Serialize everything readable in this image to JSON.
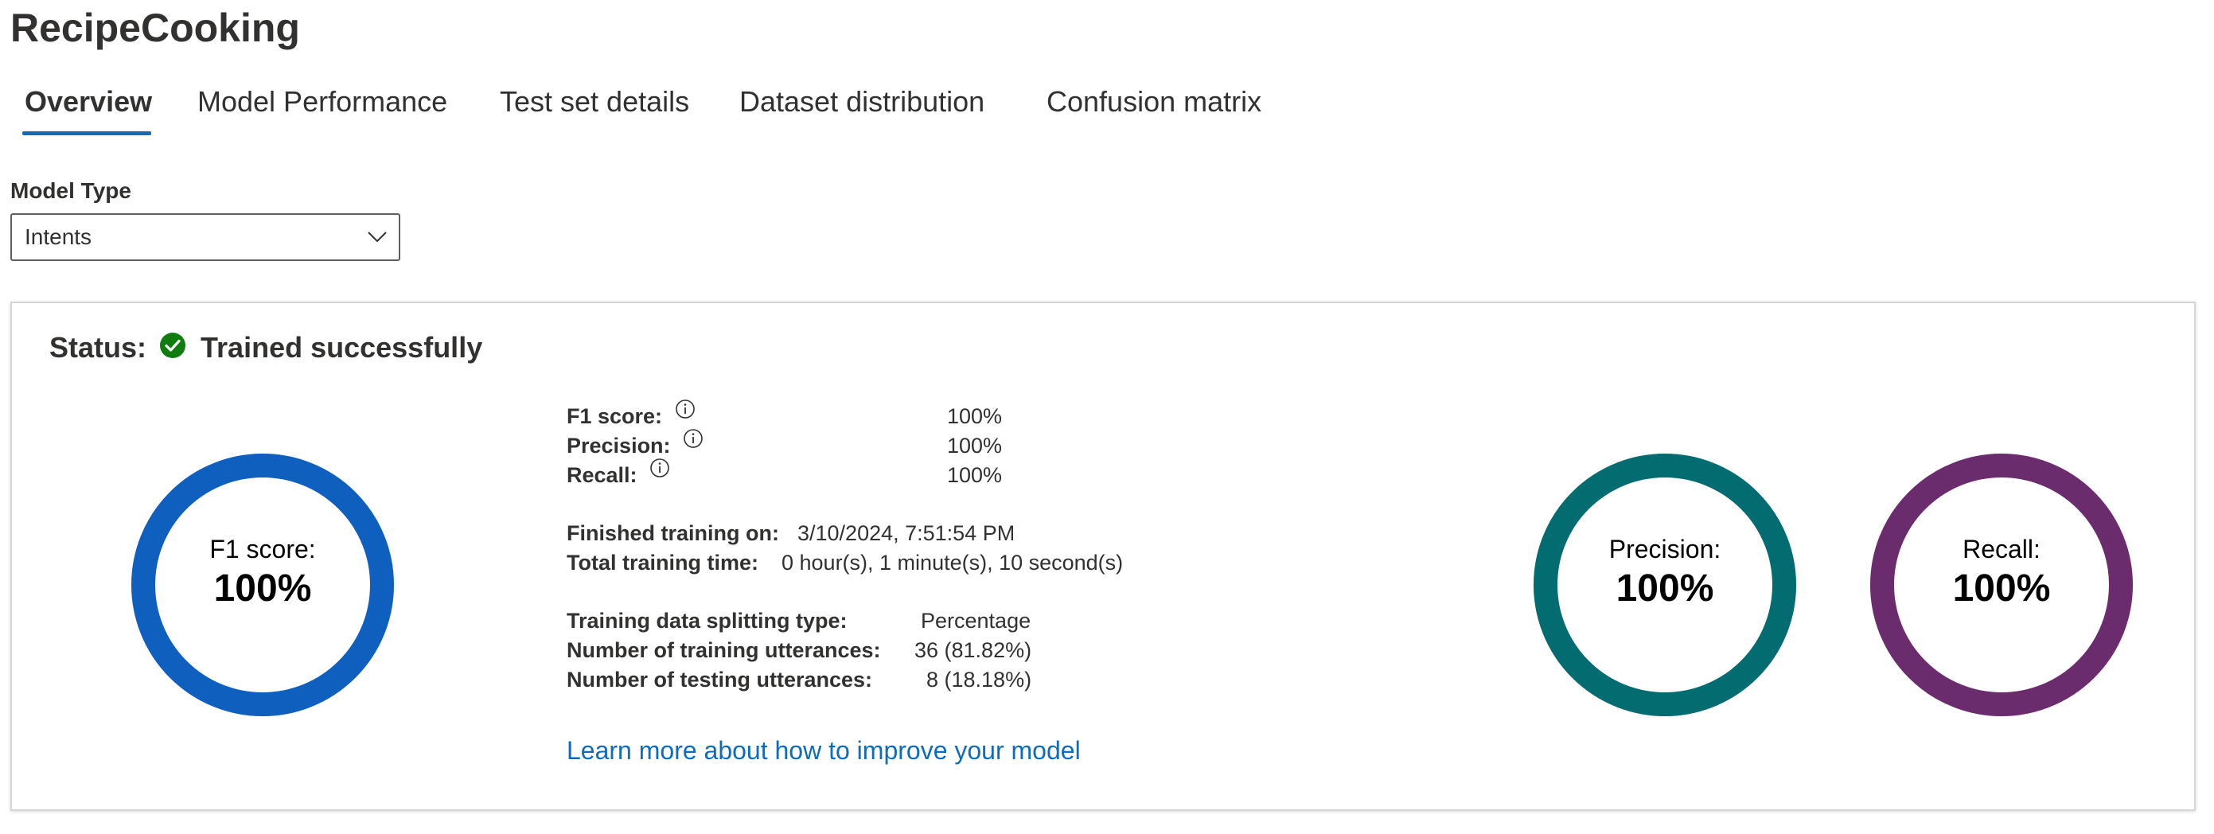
{
  "title": "RecipeCooking",
  "tabs": [
    {
      "label": "Overview",
      "active": true
    },
    {
      "label": "Model Performance",
      "active": false
    },
    {
      "label": "Test set details",
      "active": false
    },
    {
      "label": "Dataset distribution",
      "active": false
    },
    {
      "label": "Confusion matrix",
      "active": false
    }
  ],
  "model_type": {
    "label": "Model Type",
    "selected": "Intents",
    "icon": "chevron-down-icon"
  },
  "status": {
    "label": "Status:",
    "text": "Trained successfully",
    "icon": "check-circle-icon",
    "icon_color": "#107c10"
  },
  "metrics": {
    "f1": {
      "label": "F1 score:",
      "value": "100%",
      "fraction": 1.0,
      "color": "#0f5fbf"
    },
    "precision": {
      "label": "Precision:",
      "value": "100%",
      "fraction": 1.0,
      "color": "#036c70"
    },
    "recall": {
      "label": "Recall:",
      "value": "100%",
      "fraction": 1.0,
      "color": "#6b2c6e"
    }
  },
  "details": {
    "f1_label": "F1 score:",
    "f1_value": "100%",
    "precision_label": "Precision:",
    "precision_value": "100%",
    "recall_label": "Recall:",
    "recall_value": "100%",
    "finished_label": "Finished training on:",
    "finished_value": "3/10/2024, 7:51:54 PM",
    "total_time_label": "Total training time:",
    "total_time_value": "0 hour(s), 1 minute(s), 10 second(s)",
    "split_type_label": "Training data splitting type:",
    "split_type_value": "Percentage",
    "train_utt_label": "Number of training utterances:",
    "train_utt_value": "36 (81.82%)",
    "test_utt_label": "Number of testing utterances:",
    "test_utt_value": "8 (18.18%)"
  },
  "learn_more": "Learn more about how to improve your model",
  "colors": {
    "accent": "#0f6cbd",
    "link": "#0f6cbd"
  }
}
